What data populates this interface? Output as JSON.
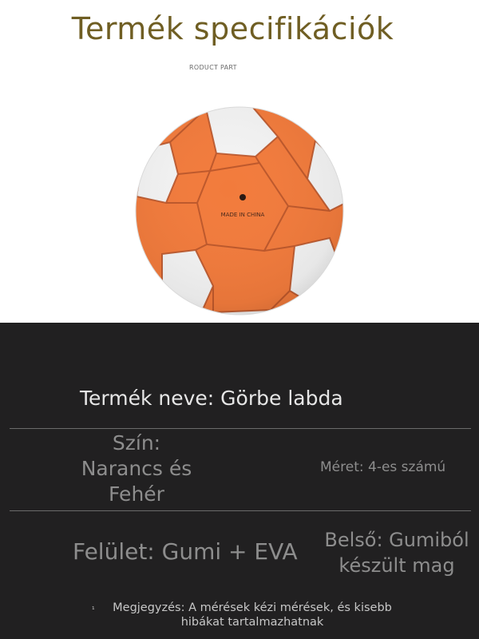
{
  "header": {
    "title": "Termék specifikációk"
  },
  "product_image": {
    "top_caption": "RODUCT PART",
    "ball_print": "MADE IN CHINA",
    "colors": {
      "orange": "#f27b3c",
      "white": "#f3f3f3",
      "stitch": "#b8552a"
    }
  },
  "specs": {
    "name": "Termék neve: Görbe labda",
    "color": {
      "line1": "Szín:",
      "line2": "Narancs és",
      "line3": "Fehér"
    },
    "size": "Méret: 4-es számú",
    "surface": "Felület: Gumi + EVA",
    "inner": {
      "line1": "Belső: Gumiból",
      "line2": "készült mag"
    },
    "note": {
      "line1": "Megjegyzés: A mérések kézi mérések, és kisebb",
      "line2": "hibákat tartalmazhatnak"
    }
  },
  "theme": {
    "title_color": "#6f5e23",
    "panel_bg": "#212021",
    "divider": "#6b6b6b"
  }
}
